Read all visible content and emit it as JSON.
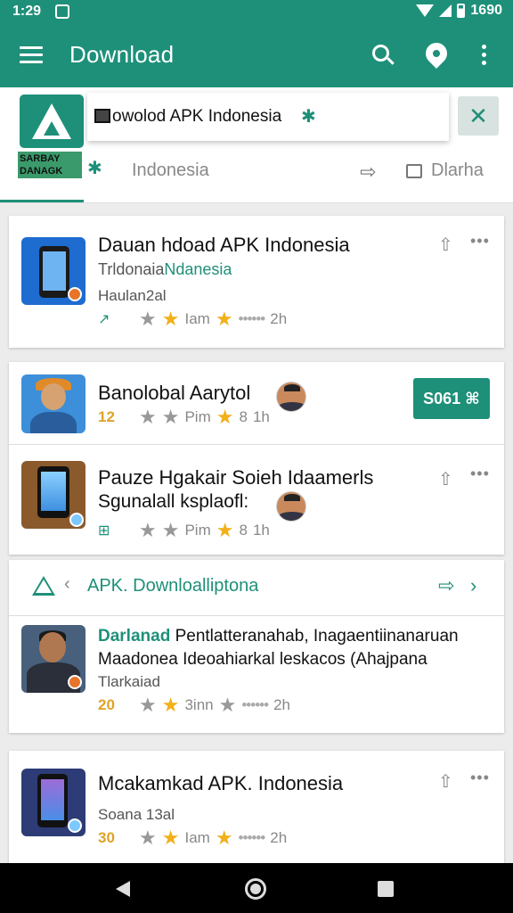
{
  "status": {
    "time": "1:29",
    "right_text": "1690"
  },
  "appbar": {
    "title": "Download"
  },
  "header": {
    "logo_caption": "SARBAY DANAGK",
    "search_text": "owolod APK Indonesia",
    "tab_label": "Indonesia",
    "tab_right": "Dlarha"
  },
  "apps": [
    {
      "title": "Dauan hdoad APK Indonesia",
      "subtitle": "Trldonaia",
      "subtitle_green": "Ndanesia",
      "line3": "Haulan2al",
      "meta_lead": "↗",
      "meta_mid": "Iam",
      "meta_time": "2h"
    },
    {
      "title": "Banolobal Aarytol",
      "meta_lead": "12",
      "meta_mid": "Pim",
      "meta_small": "8",
      "meta_time": "1h",
      "button": "S061 ⌘"
    },
    {
      "title": "Pauze Hgakair Soieh Idaamerls",
      "subtitle": "Sgunalall ksplaofl:",
      "meta_mid": "Pim",
      "meta_small": "8",
      "meta_time": "1h"
    },
    {
      "title_bold": "Darlanad",
      "title": "Pentlatteranahab, Inagaentiinanaruan",
      "subtitle": "Maadonea Ideoahiarkal leskacos (Ahajpana",
      "line3": "Tlarkaiad",
      "meta_lead": "20",
      "meta_mid": "3inn",
      "meta_time": "2h"
    },
    {
      "title": "Mcakamkad APK. Indonesia",
      "subtitle": "Soana 13al",
      "meta_lead": "30",
      "meta_mid": "Iam",
      "meta_time": "2h"
    }
  ],
  "section": {
    "label": "APK. Downloalliptona"
  },
  "colors": {
    "primary": "#1e9079",
    "star": "#f2b019",
    "accent_orange": "#e8732a"
  }
}
